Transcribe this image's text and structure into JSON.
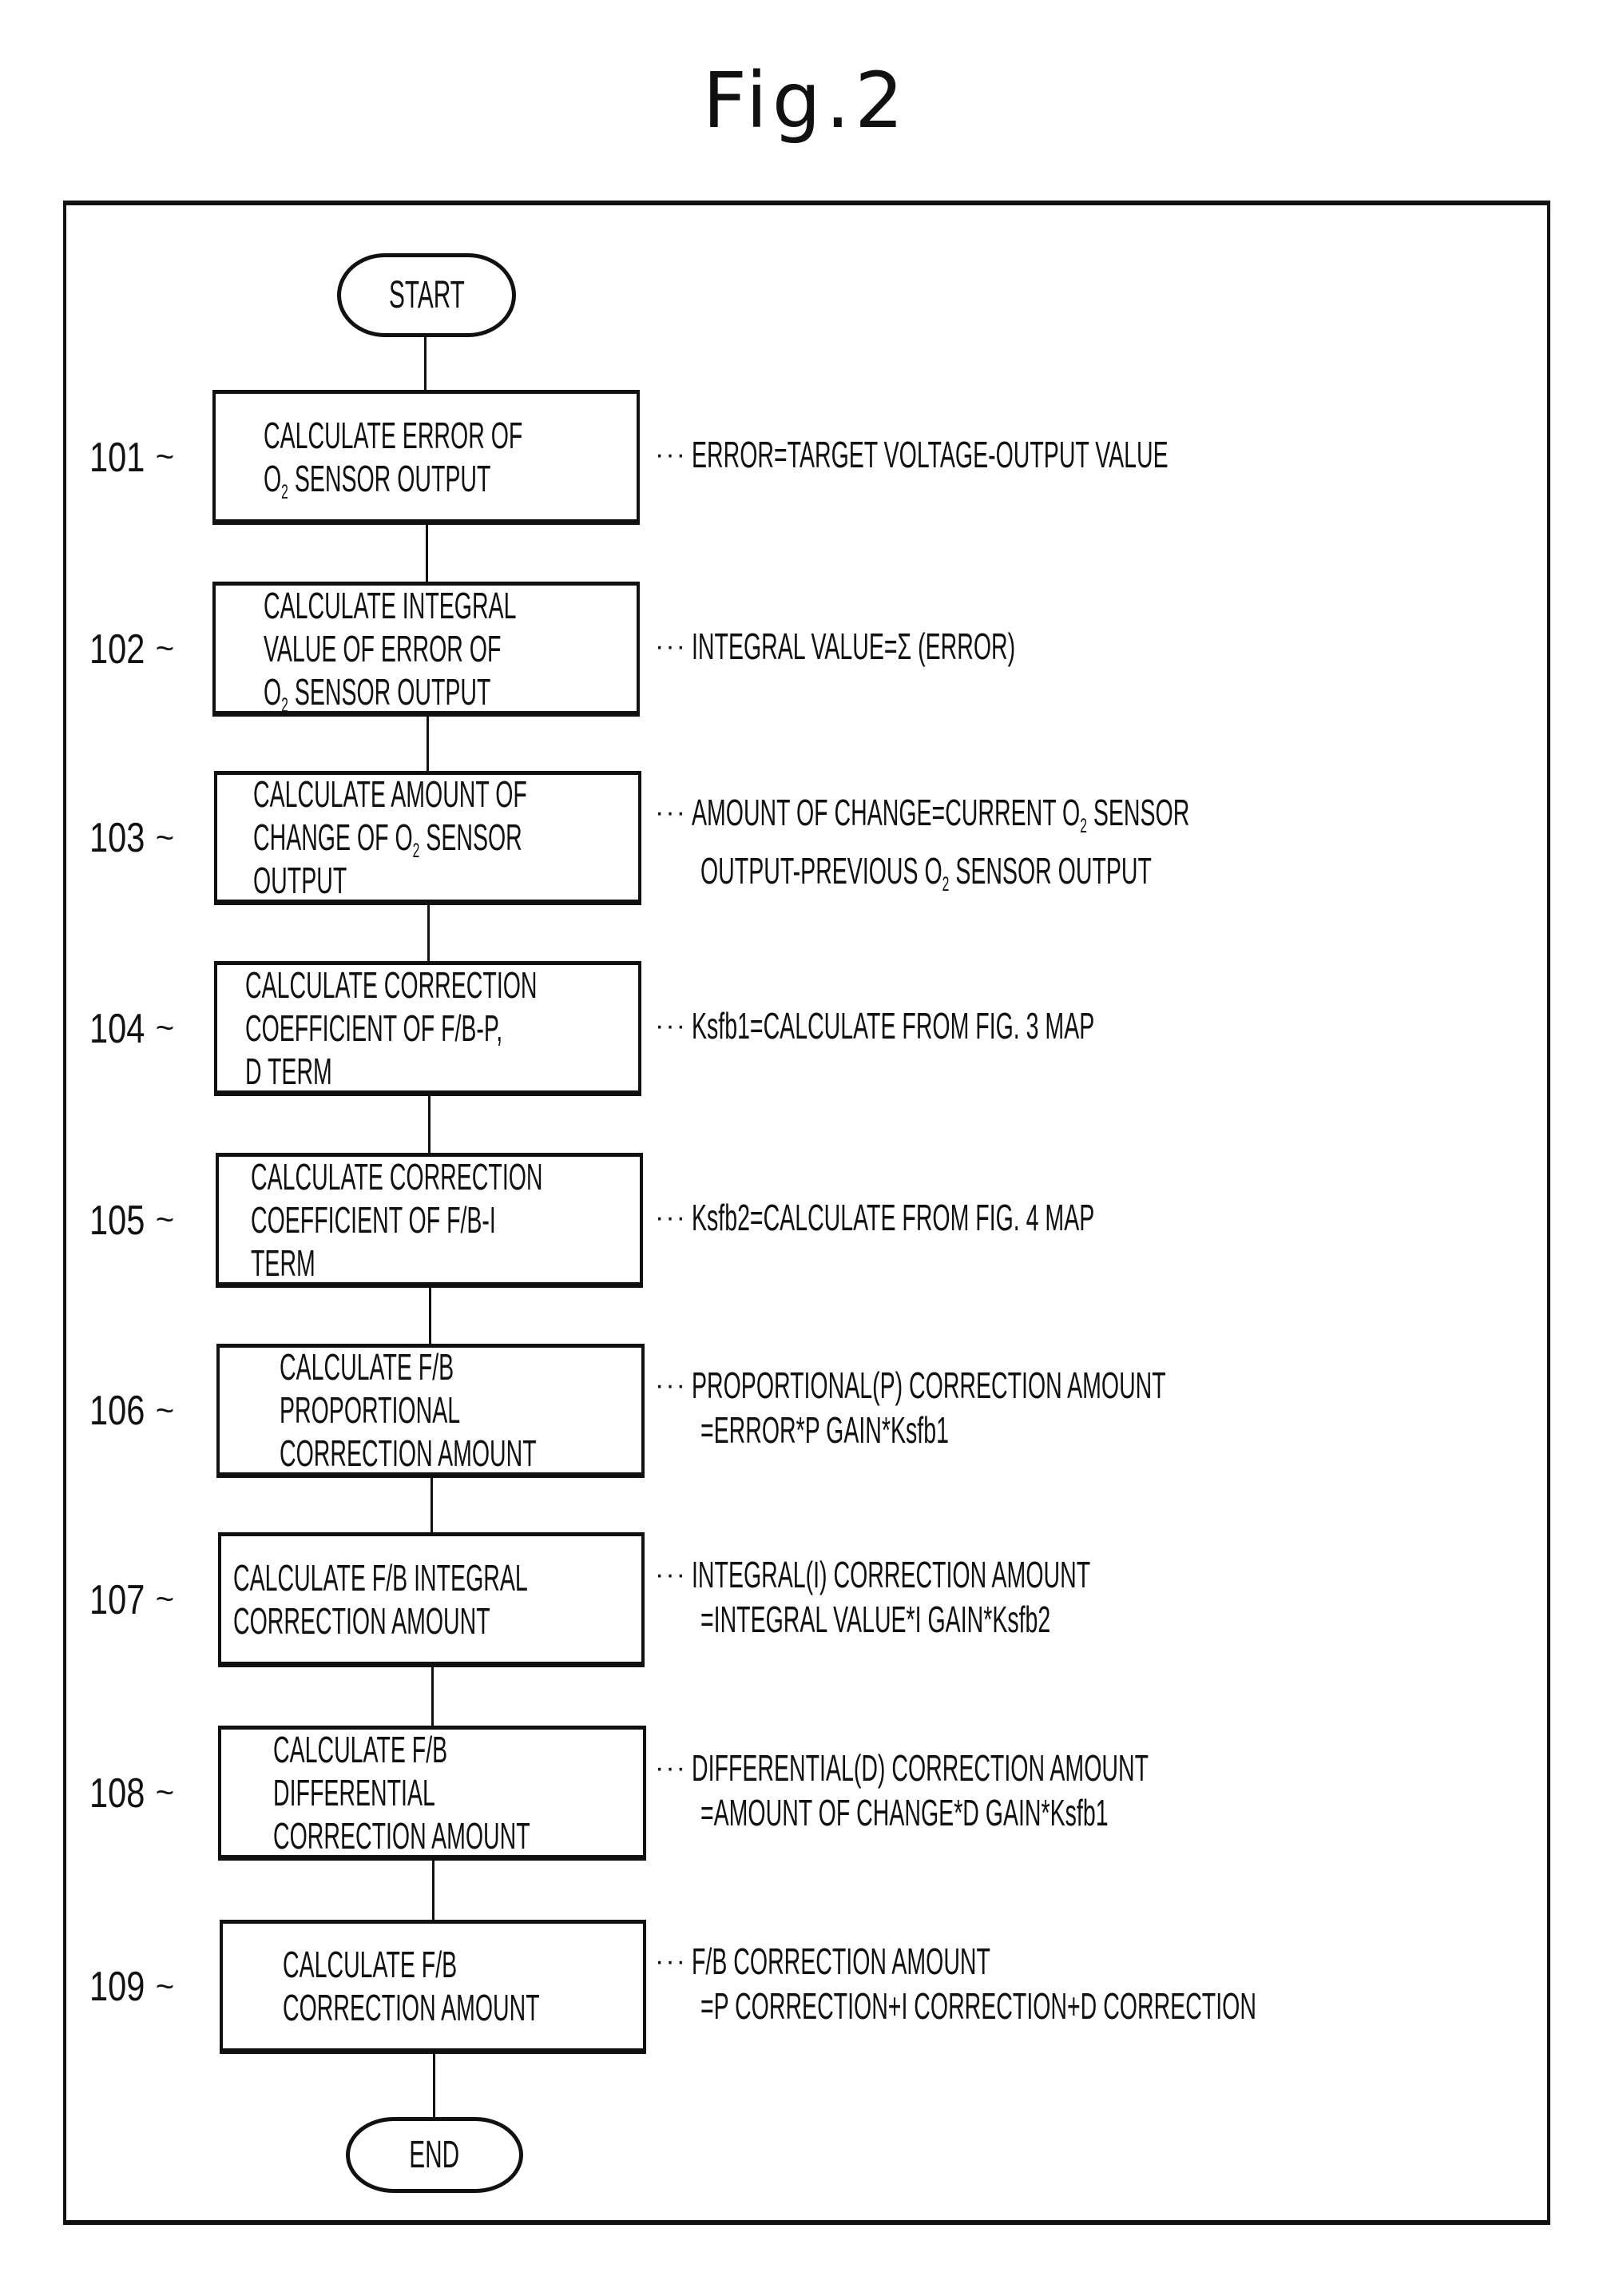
{
  "figure_title": "Fig.2",
  "start_label": "START",
  "end_label": "END",
  "steps": [
    {
      "id": "101",
      "lines": [
        "CALCULATE ERROR OF",
        "O₂ SENSOR OUTPUT"
      ],
      "note": [
        "ERROR=TARGET VOLTAGE-OUTPUT VALUE"
      ]
    },
    {
      "id": "102",
      "lines": [
        "CALCULATE INTEGRAL",
        "VALUE OF ERROR OF",
        "O₂ SENSOR OUTPUT"
      ],
      "note": [
        "INTEGRAL VALUE=Σ (ERROR)"
      ]
    },
    {
      "id": "103",
      "lines": [
        "CALCULATE AMOUNT OF",
        "CHANGE OF O₂ SENSOR",
        "OUTPUT"
      ],
      "note": [
        "AMOUNT OF CHANGE=CURRENT O₂ SENSOR",
        "OUTPUT-PREVIOUS O₂ SENSOR OUTPUT"
      ]
    },
    {
      "id": "104",
      "lines": [
        "CALCULATE CORRECTION",
        "COEFFICIENT OF F/B-P,",
        "D TERM"
      ],
      "note": [
        "Ksfb1=CALCULATE FROM FIG. 3 MAP"
      ]
    },
    {
      "id": "105",
      "lines": [
        "CALCULATE CORRECTION",
        "COEFFICIENT OF F/B-I",
        "TERM"
      ],
      "note": [
        "Ksfb2=CALCULATE FROM FIG. 4 MAP"
      ]
    },
    {
      "id": "106",
      "lines": [
        "CALCULATE F/B",
        "PROPORTIONAL",
        "CORRECTION AMOUNT"
      ],
      "note": [
        "PROPORTIONAL(P) CORRECTION AMOUNT",
        "=ERROR*P GAIN*Ksfb1"
      ]
    },
    {
      "id": "107",
      "lines": [
        "CALCULATE F/B INTEGRAL",
        "CORRECTION AMOUNT"
      ],
      "note": [
        "INTEGRAL(I) CORRECTION AMOUNT",
        "=INTEGRAL VALUE*I GAIN*Ksfb2"
      ]
    },
    {
      "id": "108",
      "lines": [
        "CALCULATE F/B",
        "DIFFERENTIAL",
        "CORRECTION AMOUNT"
      ],
      "note": [
        "DIFFERENTIAL(D) CORRECTION AMOUNT",
        "=AMOUNT OF CHANGE*D GAIN*Ksfb1"
      ]
    },
    {
      "id": "109",
      "lines": [
        "CALCULATE F/B",
        "CORRECTION AMOUNT"
      ],
      "note": [
        "F/B CORRECTION AMOUNT",
        "=P CORRECTION+I CORRECTION+D CORRECTION"
      ]
    }
  ],
  "note_prefix": "···",
  "label_suffix": "~"
}
